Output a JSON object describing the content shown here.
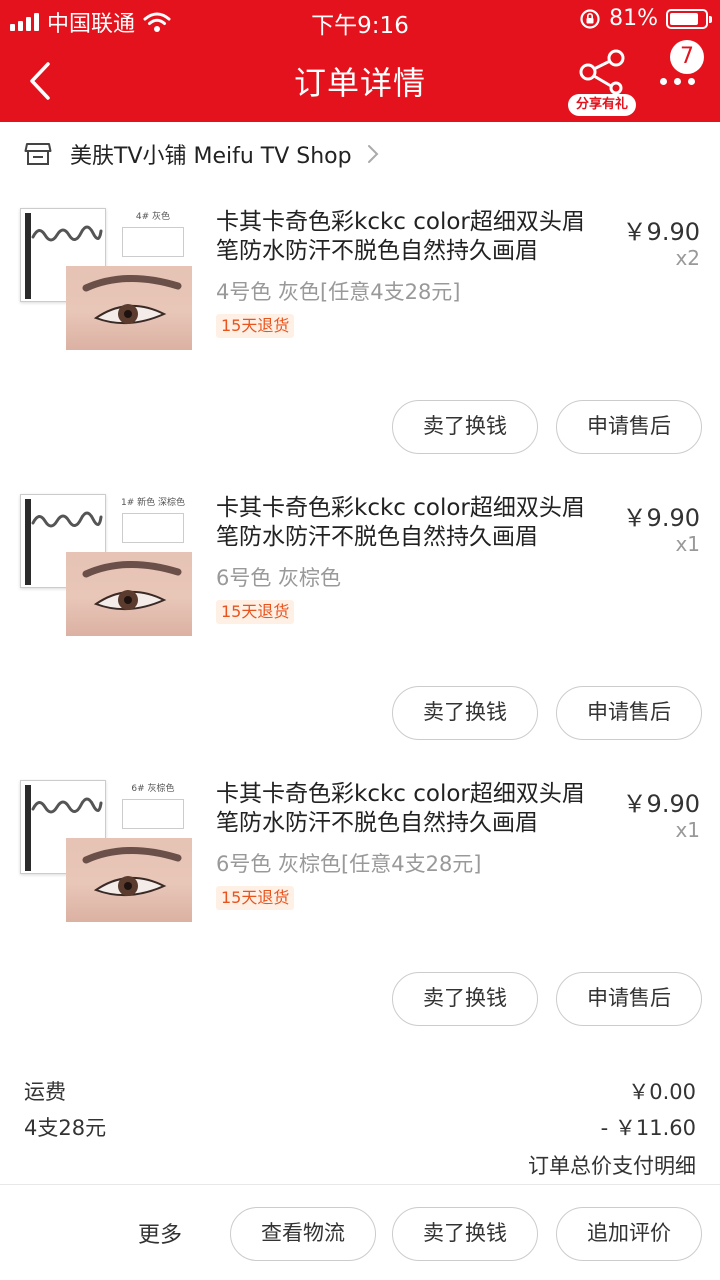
{
  "status_bar": {
    "carrier": "中国联通",
    "time": "下午9:16",
    "battery_percent": "81%",
    "battery_level": 0.81
  },
  "nav": {
    "title": "订单详情",
    "share_label": "分享有礼",
    "message_badge": "7"
  },
  "shop": {
    "name": "美肤TV小铺 Meifu TV Shop"
  },
  "items": [
    {
      "title": "卡其卡奇色彩kckc color超细双头眉笔防水防汗不脱色自然持久画眉",
      "price": "￥9.90",
      "qty": "x2",
      "spec": "4号色 灰色[任意4支28元]",
      "tag": "15天退货",
      "thumb_label": "4# 灰色",
      "sell_btn": "卖了换钱",
      "after_sale_btn": "申请售后"
    },
    {
      "title": "卡其卡奇色彩kckc color超细双头眉笔防水防汗不脱色自然持久画眉",
      "price": "￥9.90",
      "qty": "x1",
      "spec": "6号色 灰棕色",
      "tag": "15天退货",
      "thumb_label": "1# 新色 深棕色",
      "sell_btn": "卖了换钱",
      "after_sale_btn": "申请售后"
    },
    {
      "title": "卡其卡奇色彩kckc color超细双头眉笔防水防汗不脱色自然持久画眉",
      "price": "￥9.90",
      "qty": "x1",
      "spec": "6号色 灰棕色[任意4支28元]",
      "tag": "15天退货",
      "thumb_label": "6# 灰棕色",
      "sell_btn": "卖了换钱",
      "after_sale_btn": "申请售后"
    }
  ],
  "summary": {
    "shipping_label": "运费",
    "shipping_value": "￥0.00",
    "discount_label": "4支28元",
    "discount_value": "- ￥11.60",
    "detail_link": "订单总价支付明细"
  },
  "bottom_bar": {
    "more": "更多",
    "logistics": "查看物流",
    "sell": "卖了换钱",
    "review": "追加评价"
  },
  "colors": {
    "brand_red": "#e4121c",
    "tag_orange": "#e8541e"
  }
}
